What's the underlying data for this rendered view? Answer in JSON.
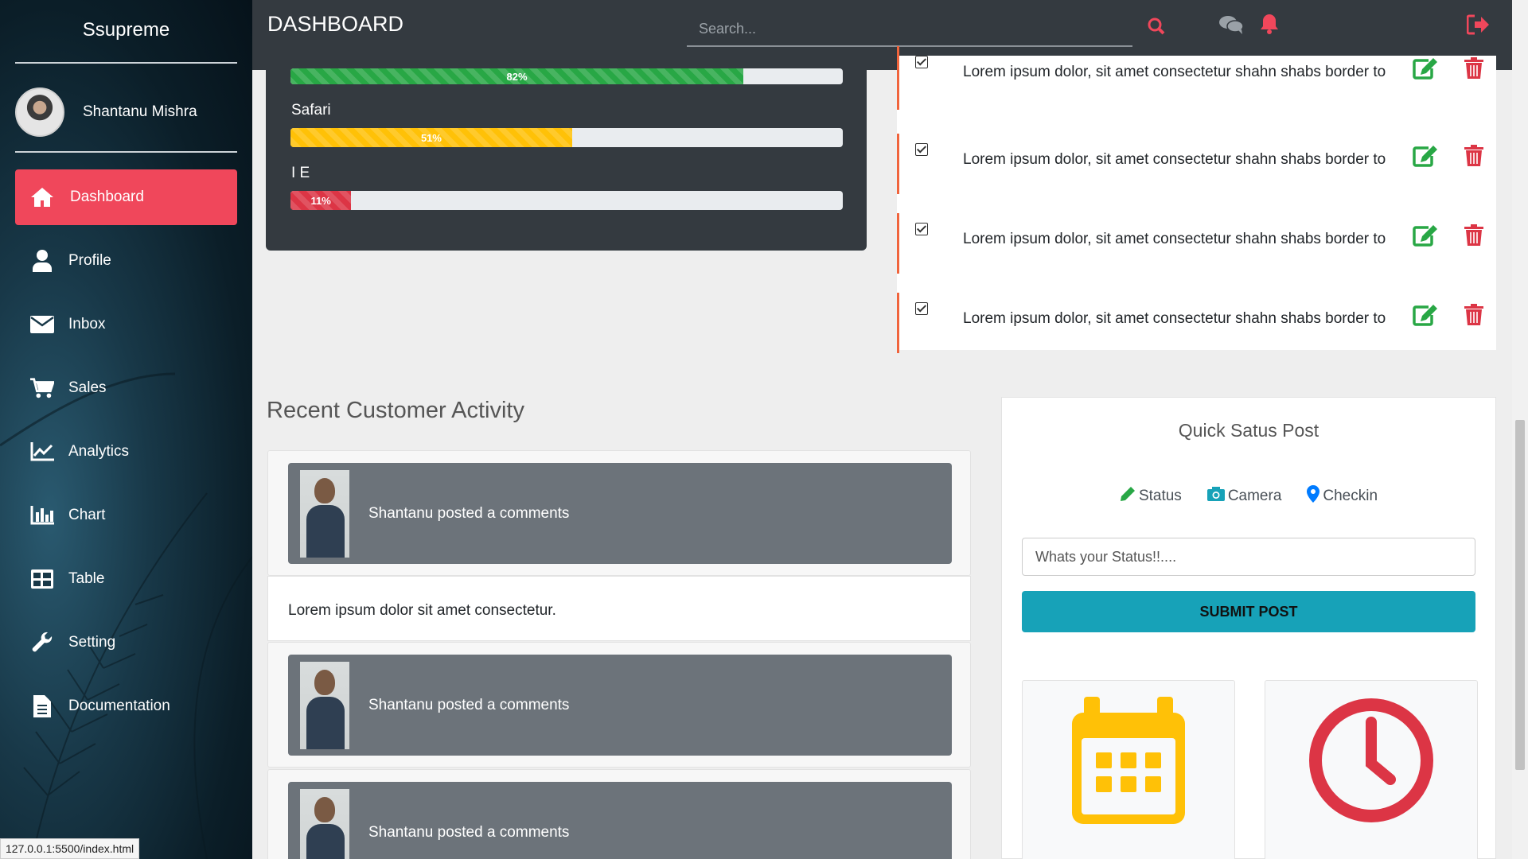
{
  "sidebar": {
    "brand": "Ssupreme",
    "user_name": "Shantanu Mishra",
    "items": [
      {
        "label": "Dashboard",
        "icon": "home-icon",
        "active": true
      },
      {
        "label": "Profile",
        "icon": "user-icon"
      },
      {
        "label": "Inbox",
        "icon": "envelope-icon"
      },
      {
        "label": "Sales",
        "icon": "cart-icon"
      },
      {
        "label": "Analytics",
        "icon": "line-chart-icon"
      },
      {
        "label": "Chart",
        "icon": "bar-chart-icon"
      },
      {
        "label": "Table",
        "icon": "table-icon"
      },
      {
        "label": "Setting",
        "icon": "wrench-icon"
      },
      {
        "label": "Documentation",
        "icon": "document-icon"
      }
    ]
  },
  "header": {
    "title": "DASHBOARD",
    "search_placeholder": "Search...",
    "icons": [
      "search-icon",
      "comments-icon",
      "bell-icon",
      "sign-out-icon"
    ]
  },
  "browser_stats": [
    {
      "label": "",
      "percent": 82,
      "percent_text": "82%",
      "color": "#28a745"
    },
    {
      "label": "Safari",
      "percent": 51,
      "percent_text": "51%",
      "color": "#ffc107"
    },
    {
      "label": "I E",
      "percent": 11,
      "percent_text": "11%",
      "color": "#dc3545"
    }
  ],
  "tasks": [
    {
      "text": "Lorem ipsum dolor, sit amet consectetur shahn shabs border to",
      "checked": true
    },
    {
      "text": "Lorem ipsum dolor, sit amet consectetur shahn shabs border to",
      "checked": true
    },
    {
      "text": "Lorem ipsum dolor, sit amet consectetur shahn shabs border to",
      "checked": true
    },
    {
      "text": "Lorem ipsum dolor, sit amet consectetur shahn shabs border to",
      "checked": true
    }
  ],
  "recent_activity": {
    "title": "Recent Customer Activity",
    "items": [
      {
        "type": "post",
        "text": "Shantanu posted a comments"
      },
      {
        "type": "comment",
        "text": "Lorem ipsum dolor sit amet consectetur."
      },
      {
        "type": "post",
        "text": "Shantanu posted a comments"
      },
      {
        "type": "post",
        "text": "Shantanu posted a comments"
      }
    ]
  },
  "quick_status": {
    "title": "Quick Satus Post",
    "options": [
      {
        "label": "Status",
        "icon": "pencil-icon",
        "color": "#28a745"
      },
      {
        "label": "Camera",
        "icon": "camera-icon",
        "color": "#17a2b8"
      },
      {
        "label": "Checkin",
        "icon": "map-marker-icon",
        "color": "#007bff"
      }
    ],
    "input_placeholder": "Whats your Status!!....",
    "submit_label": "SUBMIT POST",
    "tiles": [
      {
        "icon": "calendar-icon",
        "color": "#ffc107"
      },
      {
        "icon": "clock-icon",
        "color": "#dc3545"
      }
    ]
  },
  "status_bar_url": "127.0.0.1:5500/index.html",
  "colors": {
    "accent_red": "#f0475b",
    "header_bg": "#343a40",
    "task_border": "#f0643c",
    "teal": "#17a2b8"
  }
}
